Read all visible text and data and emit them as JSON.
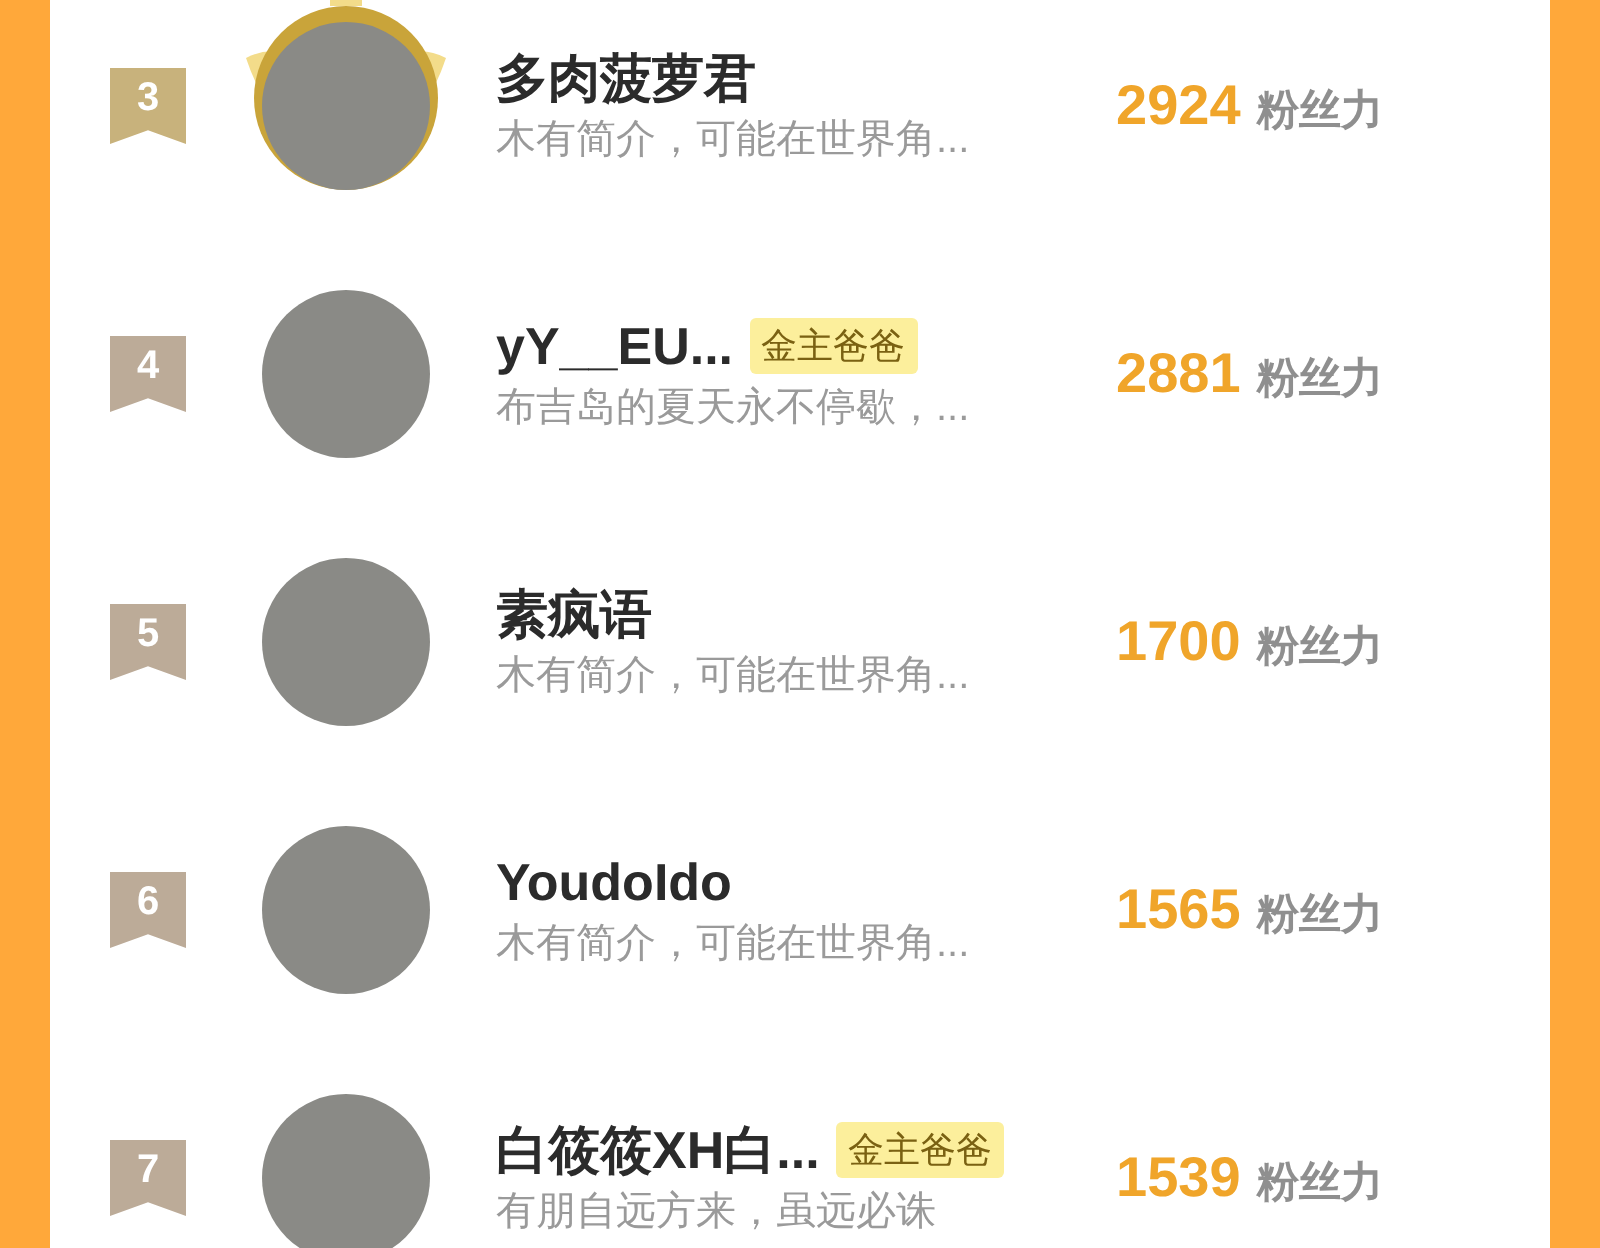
{
  "ranking": [
    {
      "rank": "3",
      "color": "#c8b27c",
      "winged": true,
      "name": "多肉菠萝君",
      "bio": "木有简介，可能在世界角...",
      "score": "2924",
      "score_unit": "粉丝力"
    },
    {
      "rank": "4",
      "color": "#bcab98",
      "winged": false,
      "name": "yY__EU...",
      "tag": "金主爸爸",
      "bio": "布吉岛的夏天永不停歇，...",
      "score": "2881",
      "score_unit": "粉丝力"
    },
    {
      "rank": "5",
      "color": "#bcab98",
      "winged": false,
      "name": "素疯语",
      "bio": "木有简介，可能在世界角...",
      "score": "1700",
      "score_unit": "粉丝力"
    },
    {
      "rank": "6",
      "color": "#bcab98",
      "winged": false,
      "name": "YoudoIdo",
      "bio": "木有简介，可能在世界角...",
      "score": "1565",
      "score_unit": "粉丝力"
    },
    {
      "rank": "7",
      "color": "#bcab98",
      "winged": false,
      "name": "白筱筱XH白...",
      "tag": "金主爸爸",
      "bio": "有朋自远方来，虽远必诛",
      "score": "1539",
      "score_unit": "粉丝力"
    }
  ]
}
